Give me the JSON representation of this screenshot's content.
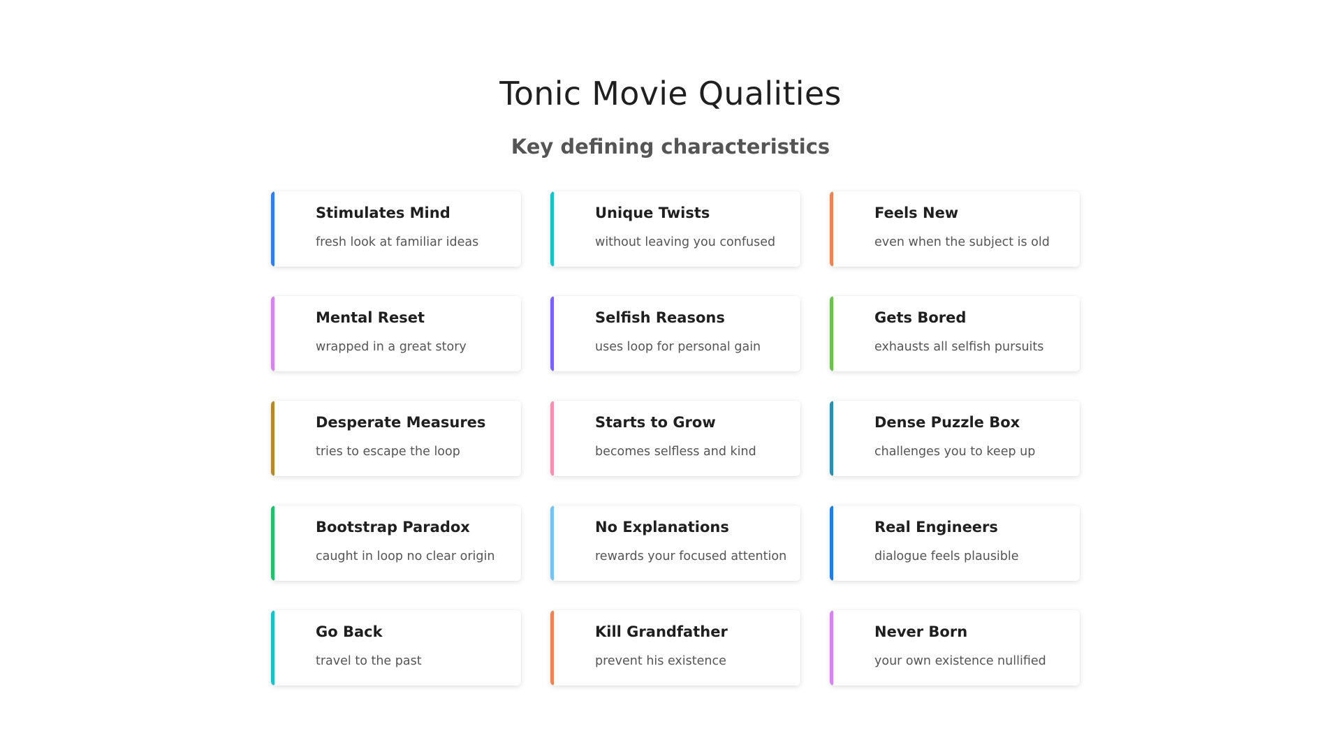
{
  "header": {
    "title": "Tonic Movie Qualities",
    "subtitle": "Key defining characteristics"
  },
  "cards": [
    {
      "title": "Stimulates Mind",
      "description": "fresh look at familiar ideas",
      "accent": "#2f80ed"
    },
    {
      "title": "Unique Twists",
      "description": "without leaving you confused",
      "accent": "#17c3c9"
    },
    {
      "title": "Feels New",
      "description": "even when the subject is old",
      "accent": "#ef8354"
    },
    {
      "title": "Mental Reset",
      "description": "wrapped in a great story",
      "accent": "#d782f0"
    },
    {
      "title": "Selfish Reasons",
      "description": "uses loop for personal gain",
      "accent": "#7b61ff"
    },
    {
      "title": "Gets Bored",
      "description": "exhausts all selfish pursuits",
      "accent": "#6cc24a"
    },
    {
      "title": "Desperate Measures",
      "description": "tries to escape the loop",
      "accent": "#b8892a"
    },
    {
      "title": "Starts to Grow",
      "description": "becomes selfless and kind",
      "accent": "#f78fb3"
    },
    {
      "title": "Dense Puzzle Box",
      "description": "challenges you to keep up",
      "accent": "#2a8fb3"
    },
    {
      "title": "Bootstrap Paradox",
      "description": "caught in loop no clear origin",
      "accent": "#1fc16b"
    },
    {
      "title": "No Explanations",
      "description": "rewards your focused attention",
      "accent": "#74c3f2"
    },
    {
      "title": "Real Engineers",
      "description": "dialogue feels plausible",
      "accent": "#1e7ee6"
    },
    {
      "title": "Go Back",
      "description": "travel to the past",
      "accent": "#17c3c9"
    },
    {
      "title": "Kill Grandfather",
      "description": "prevent his existence",
      "accent": "#ef8354"
    },
    {
      "title": "Never Born",
      "description": "your own existence nullified",
      "accent": "#d782f0"
    }
  ]
}
